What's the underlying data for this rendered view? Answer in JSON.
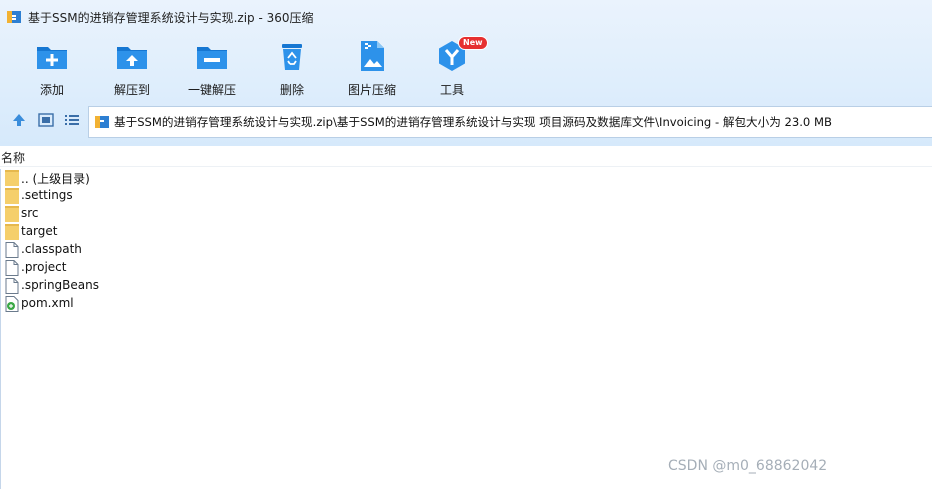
{
  "window": {
    "title": "基于SSM的进销存管理系统设计与实现.zip - 360压缩",
    "app_icon": "archive-icon"
  },
  "toolbar": {
    "items": [
      {
        "label": "添加",
        "icon": "add-folder-icon"
      },
      {
        "label": "解压到",
        "icon": "extract-folder-icon"
      },
      {
        "label": "一键解压",
        "icon": "one-click-extract-icon"
      },
      {
        "label": "删除",
        "icon": "recycle-delete-icon"
      },
      {
        "label": "图片压缩",
        "icon": "image-compress-icon"
      },
      {
        "label": "工具",
        "icon": "tools-icon",
        "badge": "New"
      }
    ]
  },
  "navbar": {
    "buttons": [
      "up-arrow-icon",
      "thumbnail-view-icon",
      "list-view-icon"
    ],
    "address": "基于SSM的进销存管理系统设计与实现.zip\\基于SSM的进销存管理系统设计与实现 项目源码及数据库文件\\Invoicing - 解包大小为 23.0 MB"
  },
  "list": {
    "column_name": "名称",
    "items": [
      {
        "name": ".. (上级目录)",
        "type": "folder"
      },
      {
        "name": ".settings",
        "type": "folder"
      },
      {
        "name": "src",
        "type": "folder"
      },
      {
        "name": "target",
        "type": "folder"
      },
      {
        "name": ".classpath",
        "type": "file"
      },
      {
        "name": ".project",
        "type": "file"
      },
      {
        "name": ".springBeans",
        "type": "file"
      },
      {
        "name": "pom.xml",
        "type": "xml"
      }
    ]
  },
  "watermark": "CSDN @m0_68862042",
  "colors": {
    "accent": "#1a8fe0",
    "badge": "#e63030",
    "folder": "#f5cf6b"
  }
}
